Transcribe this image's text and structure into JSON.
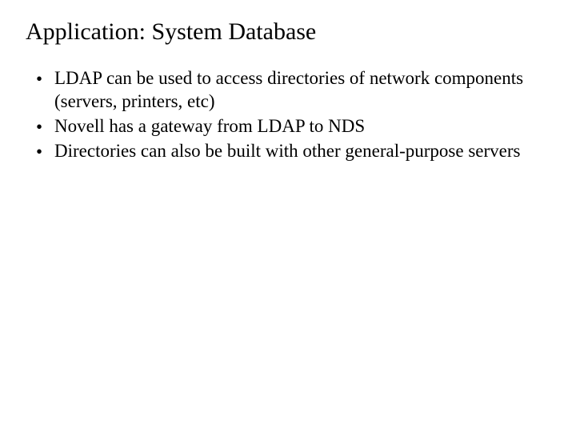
{
  "slide": {
    "title": "Application: System Database",
    "bullets": [
      "LDAP can be used to access directories of network components (servers, printers, etc)",
      "Novell has a gateway from LDAP to NDS",
      "Directories can also be built with other general-purpose servers"
    ]
  }
}
